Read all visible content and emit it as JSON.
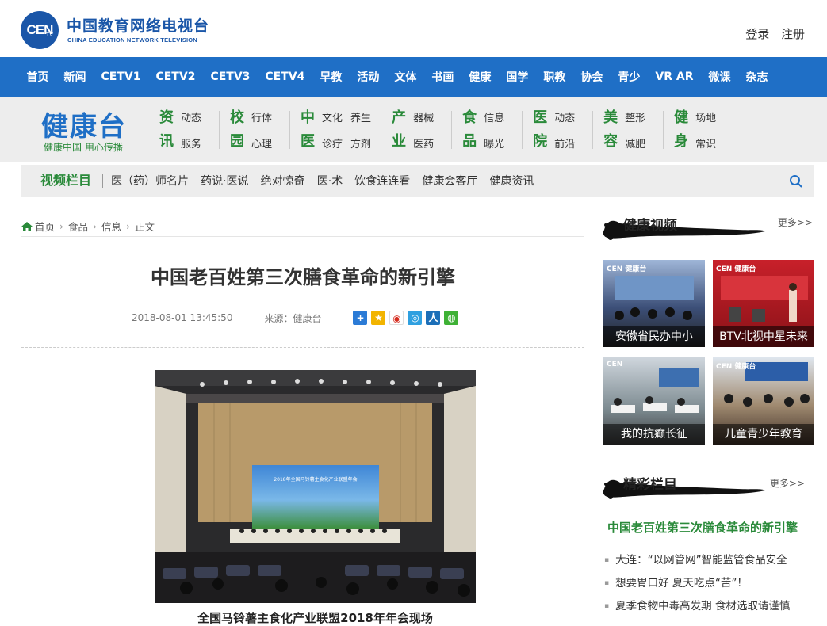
{
  "header": {
    "brand_cn": "中国教育网络电视台",
    "brand_en": "CHINA EDUCATION NETWORK TELEVISION",
    "logo": "CEN",
    "logo_sub": "TV",
    "login": "登录",
    "register": "注册"
  },
  "mainnav": [
    "首页",
    "新闻",
    "CETV1",
    "CETV2",
    "CETV3",
    "CETV4",
    "早教",
    "活动",
    "文体",
    "书画",
    "健康",
    "国学",
    "职教",
    "协会",
    "青少",
    "VR AR",
    "微课",
    "杂志"
  ],
  "channel": {
    "title": "健康台",
    "slogan": "健康中国  用心传播",
    "groups": [
      {
        "head": "资讯",
        "links": [
          "动态",
          "服务"
        ]
      },
      {
        "head": "校园",
        "links": [
          "行体",
          "心理"
        ]
      },
      {
        "head": "中医",
        "links": [
          "文化",
          "养生",
          "诊疗",
          "方剂"
        ]
      },
      {
        "head": "产业",
        "links": [
          "器械",
          "医药"
        ]
      },
      {
        "head": "食品",
        "links": [
          "信息",
          "曝光"
        ]
      },
      {
        "head": "医院",
        "links": [
          "动态",
          "前沿"
        ]
      },
      {
        "head": "美容",
        "links": [
          "整形",
          "减肥"
        ]
      },
      {
        "head": "健身",
        "links": [
          "场地",
          "常识"
        ]
      }
    ]
  },
  "videobar": {
    "title": "视频栏目",
    "links": [
      "医（药）师名片",
      "药说·医说",
      "绝对惊奇",
      "医·术",
      "饮食连连看",
      "健康会客厅",
      "健康资讯"
    ]
  },
  "breadcrumb": [
    "首页",
    "食品",
    "信息",
    "正文"
  ],
  "article": {
    "title": "中国老百姓第三次膳食革命的新引擎",
    "date": "2018-08-01 13:45:50",
    "source": "来源：健康台",
    "photo_screen_text": "2018年全国马铃薯主食化产业联盟年会",
    "caption": "全国马铃薯主食化产业联盟2018年年会现场"
  },
  "sidebar": {
    "video_title": "健康视频",
    "more": "更多>>",
    "videos": [
      {
        "caption": "安徽省民办中小",
        "tag": "CEN 健康台"
      },
      {
        "caption": "BTV北视中星未来",
        "tag": "CEN 健康台"
      },
      {
        "caption": "我的抗癫长征",
        "tag": "CEN"
      },
      {
        "caption": "儿童青少年教育",
        "tag": "CEN 健康台"
      }
    ],
    "featured_title": "精彩栏目",
    "featured_more": "更多>>",
    "featured_headline": "中国老百姓第三次膳食革命的新引擎",
    "list": [
      "大连：“以网管网”智能监管食品安全",
      "想要胃口好 夏天吃点“苦”！",
      "夏季食物中毒高发期 食材选取请谨慎"
    ]
  }
}
